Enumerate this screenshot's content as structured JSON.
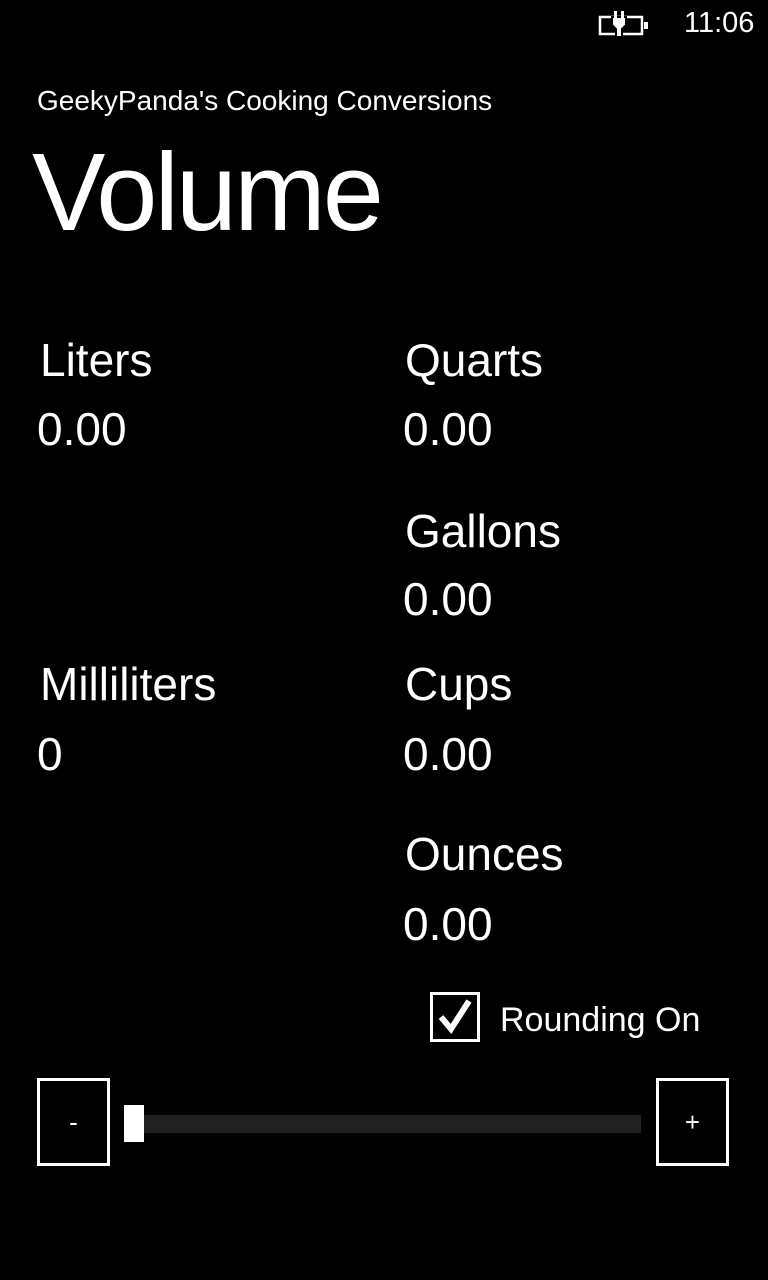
{
  "status_bar": {
    "battery_icon": "battery-charging-icon",
    "time": "11:06"
  },
  "app_title": "GeekyPanda's Cooking Conversions",
  "page_title": "Volume",
  "units": {
    "liters": {
      "label": "Liters",
      "value": "0.00"
    },
    "quarts": {
      "label": "Quarts",
      "value": "0.00"
    },
    "gallons": {
      "label": "Gallons",
      "value": "0.00"
    },
    "milliliters": {
      "label": "Milliliters",
      "value": "0"
    },
    "cups": {
      "label": "Cups",
      "value": "0.00"
    },
    "ounces": {
      "label": "Ounces",
      "value": "0.00"
    }
  },
  "rounding": {
    "label": "Rounding On",
    "checked": true
  },
  "slider": {
    "minus_label": "-",
    "plus_label": "+",
    "value_fraction": 0.0
  },
  "colors": {
    "background": "#000000",
    "foreground": "#ffffff",
    "track": "#222222"
  }
}
